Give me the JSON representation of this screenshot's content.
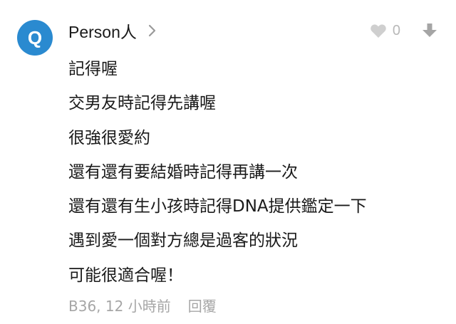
{
  "comment": {
    "avatar_letter": "Q",
    "avatar_color": "#2a8ad0",
    "author": "Person人",
    "like_count": "0",
    "lines": [
      "記得喔",
      "交男友時記得先講喔",
      "很強很愛約",
      "還有還有要結婚時記得再講一次",
      "還有還有生小孩時記得DNA提供鑑定一下",
      "遇到愛一個對方總是過客的狀況",
      "可能很適合喔！"
    ],
    "meta": "B36, 12 小時前",
    "reply_label": "回覆"
  },
  "icons": {
    "author_chevron": "chevron-right-icon",
    "like": "heart-icon",
    "menu": "arrow-down-icon"
  }
}
